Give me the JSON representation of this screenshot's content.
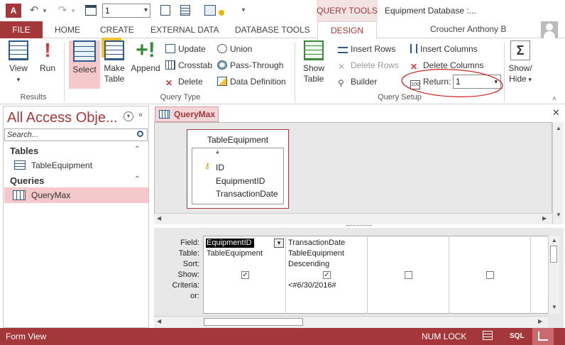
{
  "app": {
    "icon_letter": "A",
    "title": "Equipment Database :...",
    "context_tab": "QUERY TOOLS",
    "user": "Croucher Anthony B"
  },
  "quick_access": {
    "return_value": "1"
  },
  "tabs": [
    "FILE",
    "HOME",
    "CREATE",
    "EXTERNAL DATA",
    "DATABASE TOOLS",
    "DESIGN"
  ],
  "ribbon": {
    "results": {
      "label": "Results",
      "view": "View",
      "run": "Run"
    },
    "query_type": {
      "label": "Query Type",
      "select": "Select",
      "make_table": [
        "Make",
        "Table"
      ],
      "append": "Append",
      "update": "Update",
      "crosstab": "Crosstab",
      "delete": "Delete",
      "union": "Union",
      "pass_through": "Pass-Through",
      "data_definition": "Data Definition"
    },
    "query_setup": {
      "label": "Query Setup",
      "show_table": [
        "Show",
        "Table"
      ],
      "insert_rows": "Insert Rows",
      "delete_rows": "Delete Rows",
      "builder": "Builder",
      "insert_columns": "Insert Columns",
      "delete_columns": "Delete Columns",
      "return_label": "Return:",
      "return_value": "1"
    },
    "show_hide": [
      "Show/",
      "Hide"
    ]
  },
  "nav": {
    "title": "All Access Obje...",
    "search_placeholder": "Search...",
    "tables_header": "Tables",
    "tables": [
      "TableEquipment"
    ],
    "queries_header": "Queries",
    "queries": [
      "QueryMax"
    ]
  },
  "document": {
    "tab": "QueryMax",
    "table_box": {
      "title": "TableEquipment",
      "fields": [
        "*",
        "ID",
        "EquipmentID",
        "TransactionDate"
      ]
    },
    "grid": {
      "row_labels": [
        "Field:",
        "Table:",
        "Sort:",
        "Show:",
        "Criteria:",
        "or:"
      ],
      "columns": [
        {
          "field": "EquipmentID",
          "table": "TableEquipment",
          "sort": "",
          "show": true,
          "criteria": ""
        },
        {
          "field": "TransactionDate",
          "table": "TableEquipment",
          "sort": "Descending",
          "show": true,
          "criteria": "<#6/30/2016#"
        },
        {
          "field": "",
          "table": "",
          "sort": "",
          "show": false,
          "criteria": ""
        },
        {
          "field": "",
          "table": "",
          "sort": "",
          "show": false,
          "criteria": ""
        }
      ]
    }
  },
  "status": {
    "left": "Form View",
    "num_lock": "NUM LOCK",
    "sql": "SQL"
  },
  "colors": {
    "accent": "#a4373a",
    "annotation": "#cc2222"
  }
}
